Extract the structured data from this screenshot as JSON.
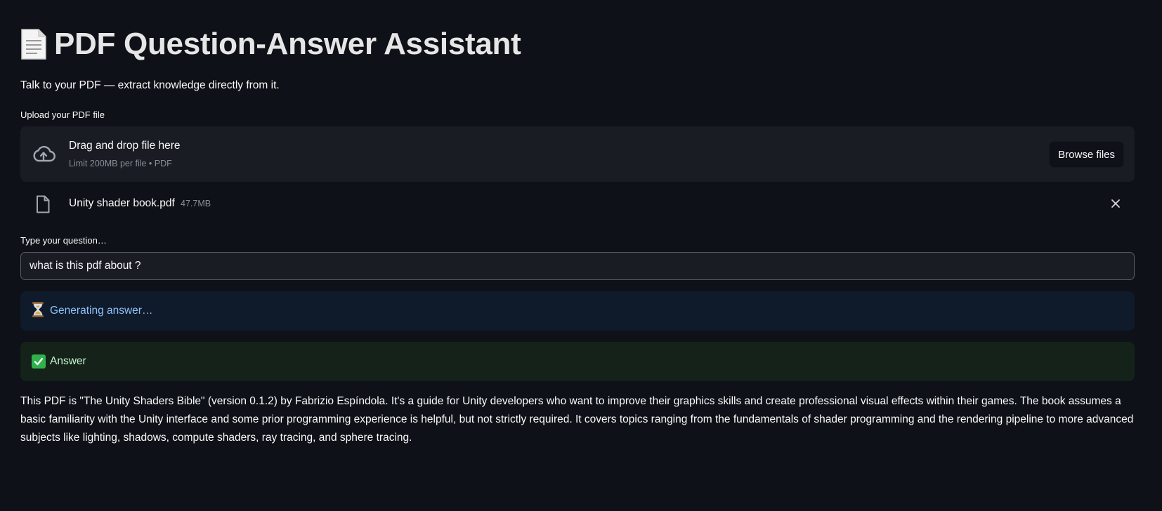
{
  "header": {
    "icon": "document-icon",
    "title": "PDF Question-Answer Assistant",
    "subtitle": "Talk to your PDF — extract knowledge directly from it."
  },
  "uploader": {
    "label": "Upload your PDF file",
    "dropzone_text": "Drag and drop file here",
    "dropzone_hint": "Limit 200MB per file • PDF",
    "browse_label": "Browse files",
    "icon": "cloud-upload-icon"
  },
  "uploaded_file": {
    "name": "Unity shader book.pdf",
    "size": "47.7MB",
    "icon": "file-icon"
  },
  "question": {
    "label": "Type your question…",
    "value": "what is this pdf about ?"
  },
  "status": {
    "icon": "hourglass-icon",
    "text": "Generating answer…"
  },
  "answer_box": {
    "icon": "check-icon",
    "label": "Answer"
  },
  "answer_text": "This PDF is \"The Unity Shaders Bible\" (version 0.1.2) by Fabrizio Espíndola. It's a guide for Unity developers who want to improve their graphics skills and create professional visual effects within their games. The book assumes a basic familiarity with the Unity interface and some prior programming experience is helpful, but not strictly required. It covers topics ranging from the fundamentals of shader programming and the rendering pipeline to more advanced subjects like lighting, shadows, compute shaders, ray tracing, and sphere tracing.",
  "colors": {
    "background": "#0e1117",
    "info_bg": "#0f1a2b",
    "info_text": "#8fc2f7",
    "success_bg": "#142219",
    "success_text": "#c8f5cf"
  }
}
